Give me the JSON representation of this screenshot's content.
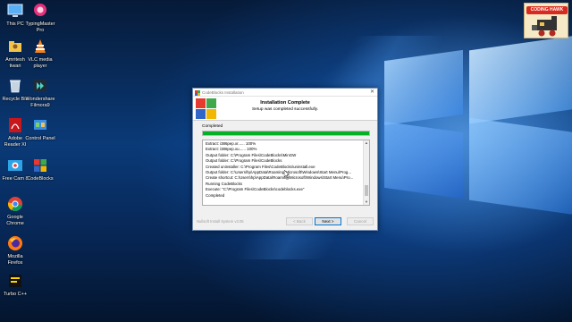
{
  "desktop": {
    "icons": [
      {
        "label": "This PC",
        "icon": "this-pc-icon"
      },
      {
        "label": "TypingMaster\nPro",
        "icon": "typingmaster-icon"
      },
      {
        "label": "Amritesh\ntiwari",
        "icon": "user-folder-icon"
      },
      {
        "label": "VLC media\nplayer",
        "icon": "vlc-icon"
      },
      {
        "label": "Recycle Bin",
        "icon": "recycle-bin-icon"
      },
      {
        "label": "Wondershare\nFilmora9",
        "icon": "filmora-icon"
      },
      {
        "label": "Adobe\nReader XI",
        "icon": "adobe-reader-icon"
      },
      {
        "label": "Control Panel",
        "icon": "control-panel-icon"
      },
      {
        "label": "Free Cam 8",
        "icon": "freecam-icon"
      },
      {
        "label": "CodeBlocks",
        "icon": "codeblocks-icon"
      },
      {
        "label": "Google\nChrome",
        "icon": "chrome-icon"
      },
      {
        "label": "Mozilla\nFirefox",
        "icon": "firefox-icon"
      },
      {
        "label": "Turbo C++",
        "icon": "turbo-cpp-icon"
      }
    ],
    "logo_text": "CODING HAWK"
  },
  "installer": {
    "window_title": "CodeBlocks Installation",
    "header_title": "Installation Complete",
    "header_subtitle": "Setup was completed successfully.",
    "status_label": "Completed",
    "progress": 1.0,
    "log_lines": [
      "Extract: i386pep.xr...... 100%",
      "Extract: i386pep.xu...... 100%",
      "Output folder: C:\\Program Files\\CodeBlocks\\MinGW",
      "Output folder: C:\\Program Files\\CodeBlocks",
      "Created uninstaller: C:\\Program Files\\CodeBlocks\\uninstall.exe",
      "Output folder: C:\\Users\\hp\\AppData\\Roaming\\Microsoft\\Windows\\Start Menu\\Prog...",
      "Create shortcut: C:\\Users\\hp\\AppData\\Roaming\\Microsoft\\Windows\\Start Menu\\Pro...",
      "Running CodeBlocks",
      "Execute: \"C:\\Program Files\\CodeBlocks\\codeblocks.exe\"",
      "Completed"
    ],
    "footer_brand": "Nullsoft Install System v3.05",
    "buttons": {
      "back": "< Back",
      "next": "Next >",
      "cancel": "Cancel"
    }
  },
  "colors": {
    "progress_fill": "#06b025",
    "desktop_blue": "#0a3a78"
  }
}
